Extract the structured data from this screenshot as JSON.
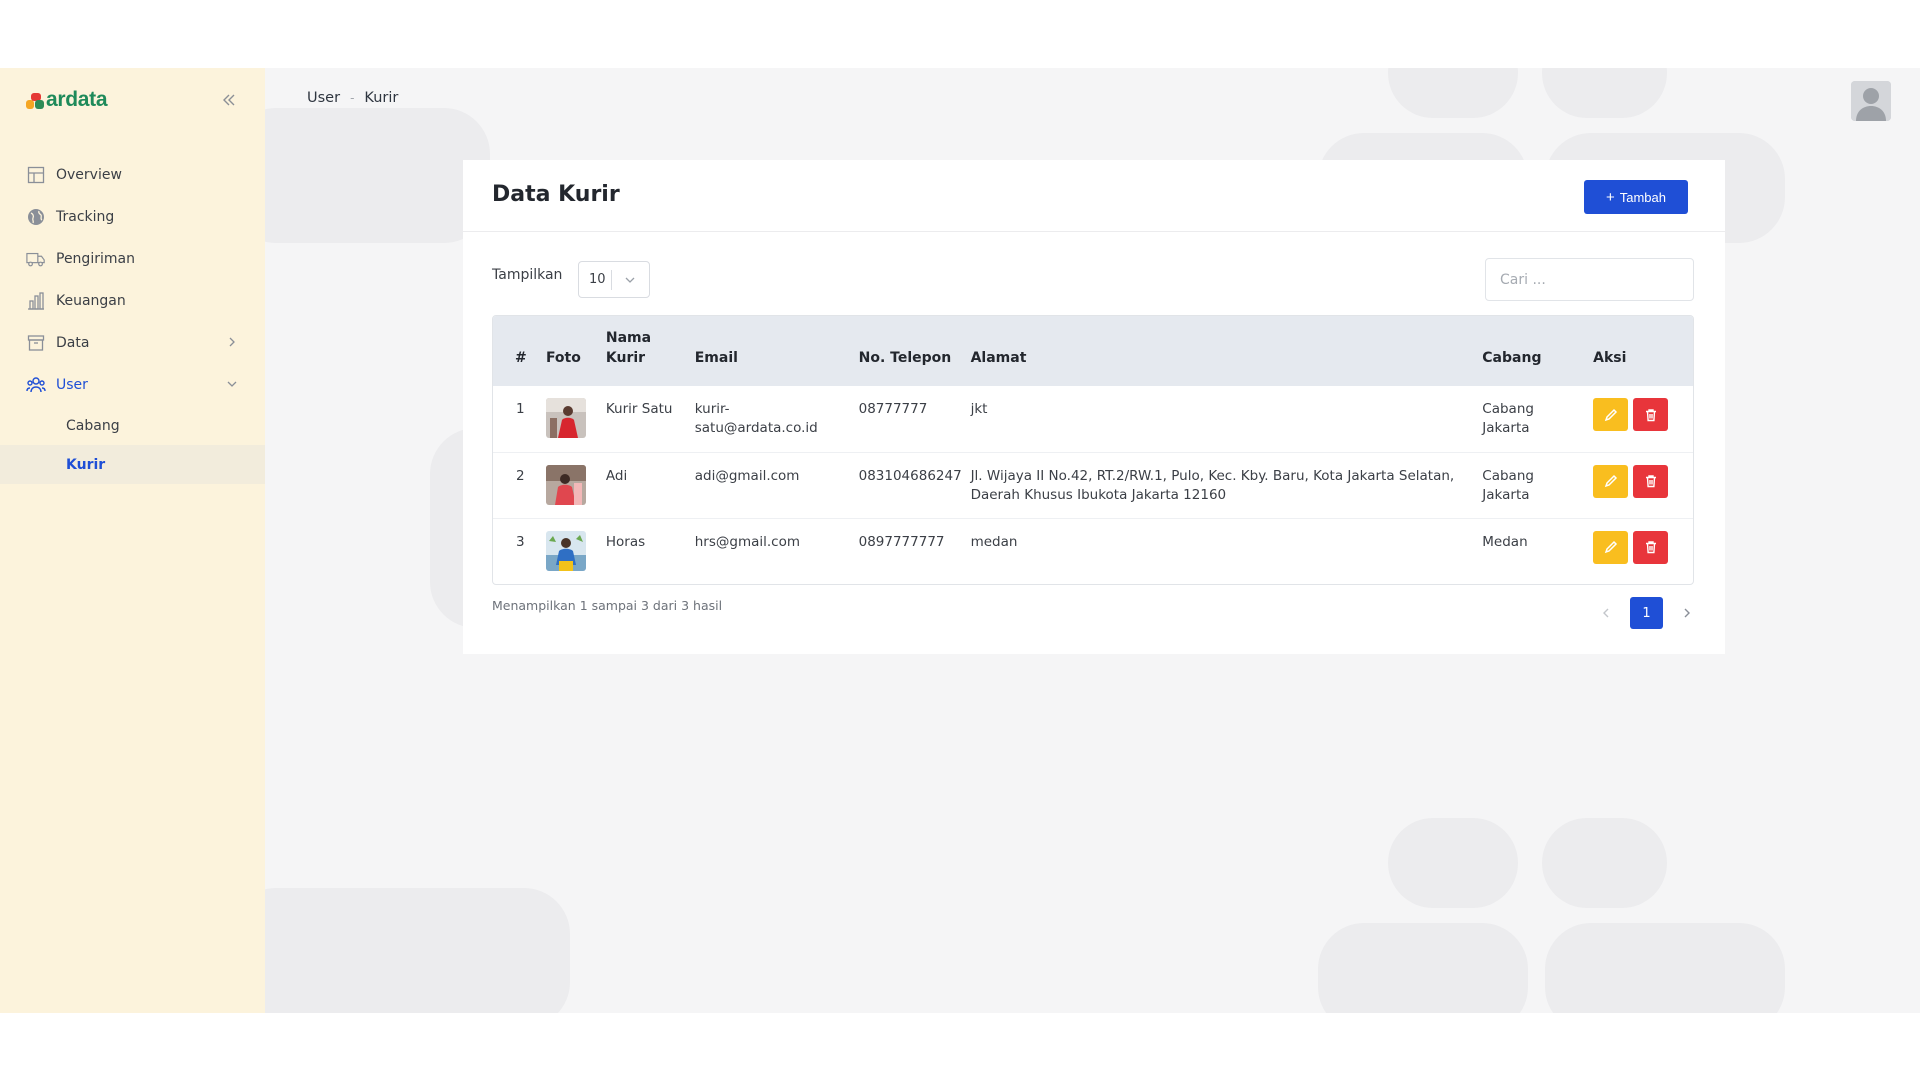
{
  "app": {
    "logo_text": "ardata",
    "brand_colors": {
      "primary": "#1f4fd6",
      "logo_green": "#1e8a5a",
      "sidebar_bg": "#fcf3dc",
      "edit": "#f9be1f",
      "delete": "#e8353b"
    }
  },
  "sidebar": {
    "collapse_icon": "double-chevron-left-icon",
    "items": [
      {
        "label": "Overview",
        "icon": "grid-icon"
      },
      {
        "label": "Tracking",
        "icon": "globe-icon"
      },
      {
        "label": "Pengiriman",
        "icon": "truck-icon"
      },
      {
        "label": "Keuangan",
        "icon": "bar-chart-icon"
      },
      {
        "label": "Data",
        "icon": "archive-icon",
        "chevron": "chevron-right-icon"
      },
      {
        "label": "User",
        "icon": "users-icon",
        "chevron": "chevron-down-icon",
        "expanded": true
      }
    ],
    "user_subitems": [
      {
        "label": "Cabang",
        "active": false
      },
      {
        "label": "Kurir",
        "active": true
      }
    ]
  },
  "breadcrumb": {
    "items": [
      "User",
      "Kurir"
    ],
    "separator": "-"
  },
  "header": {
    "avatar_icon": "user-avatar-icon"
  },
  "page": {
    "title": "Data Kurir",
    "add_button_label": "Tambah",
    "show_label": "Tampilkan",
    "page_size": "10",
    "search_placeholder": "Cari ..."
  },
  "table": {
    "columns": {
      "num": "#",
      "foto": "Foto",
      "nama_line1": "Nama",
      "nama_line2": "Kurir",
      "email": "Email",
      "telepon": "No. Telepon",
      "alamat": "Alamat",
      "cabang": "Cabang",
      "aksi": "Aksi"
    },
    "rows": [
      {
        "num": "1",
        "nama": "Kurir Satu",
        "email_line1": "kurir-",
        "email_line2": "satu@ardata.co.id",
        "telepon": "08777777",
        "alamat_line1": "jkt",
        "alamat_line2": "",
        "cabang_line1": "Cabang",
        "cabang_line2": "Jakarta"
      },
      {
        "num": "2",
        "nama": "Adi",
        "email_line1": "adi@gmail.com",
        "email_line2": "",
        "telepon": "083104686247",
        "alamat_line1": "Jl. Wijaya II No.42, RT.2/RW.1, Pulo, Kec. Kby. Baru, Kota Jakarta Selatan,",
        "alamat_line2": "Daerah Khusus Ibukota Jakarta 12160",
        "cabang_line1": "Cabang",
        "cabang_line2": "Jakarta"
      },
      {
        "num": "3",
        "nama": "Horas",
        "email_line1": "hrs@gmail.com",
        "email_line2": "",
        "telepon": "0897777777",
        "alamat_line1": "medan",
        "alamat_line2": "",
        "cabang_line1": "Medan",
        "cabang_line2": ""
      }
    ]
  },
  "footer": {
    "info": "Menampilkan 1 sampai 3 dari 3 hasil",
    "current_page": "1"
  }
}
